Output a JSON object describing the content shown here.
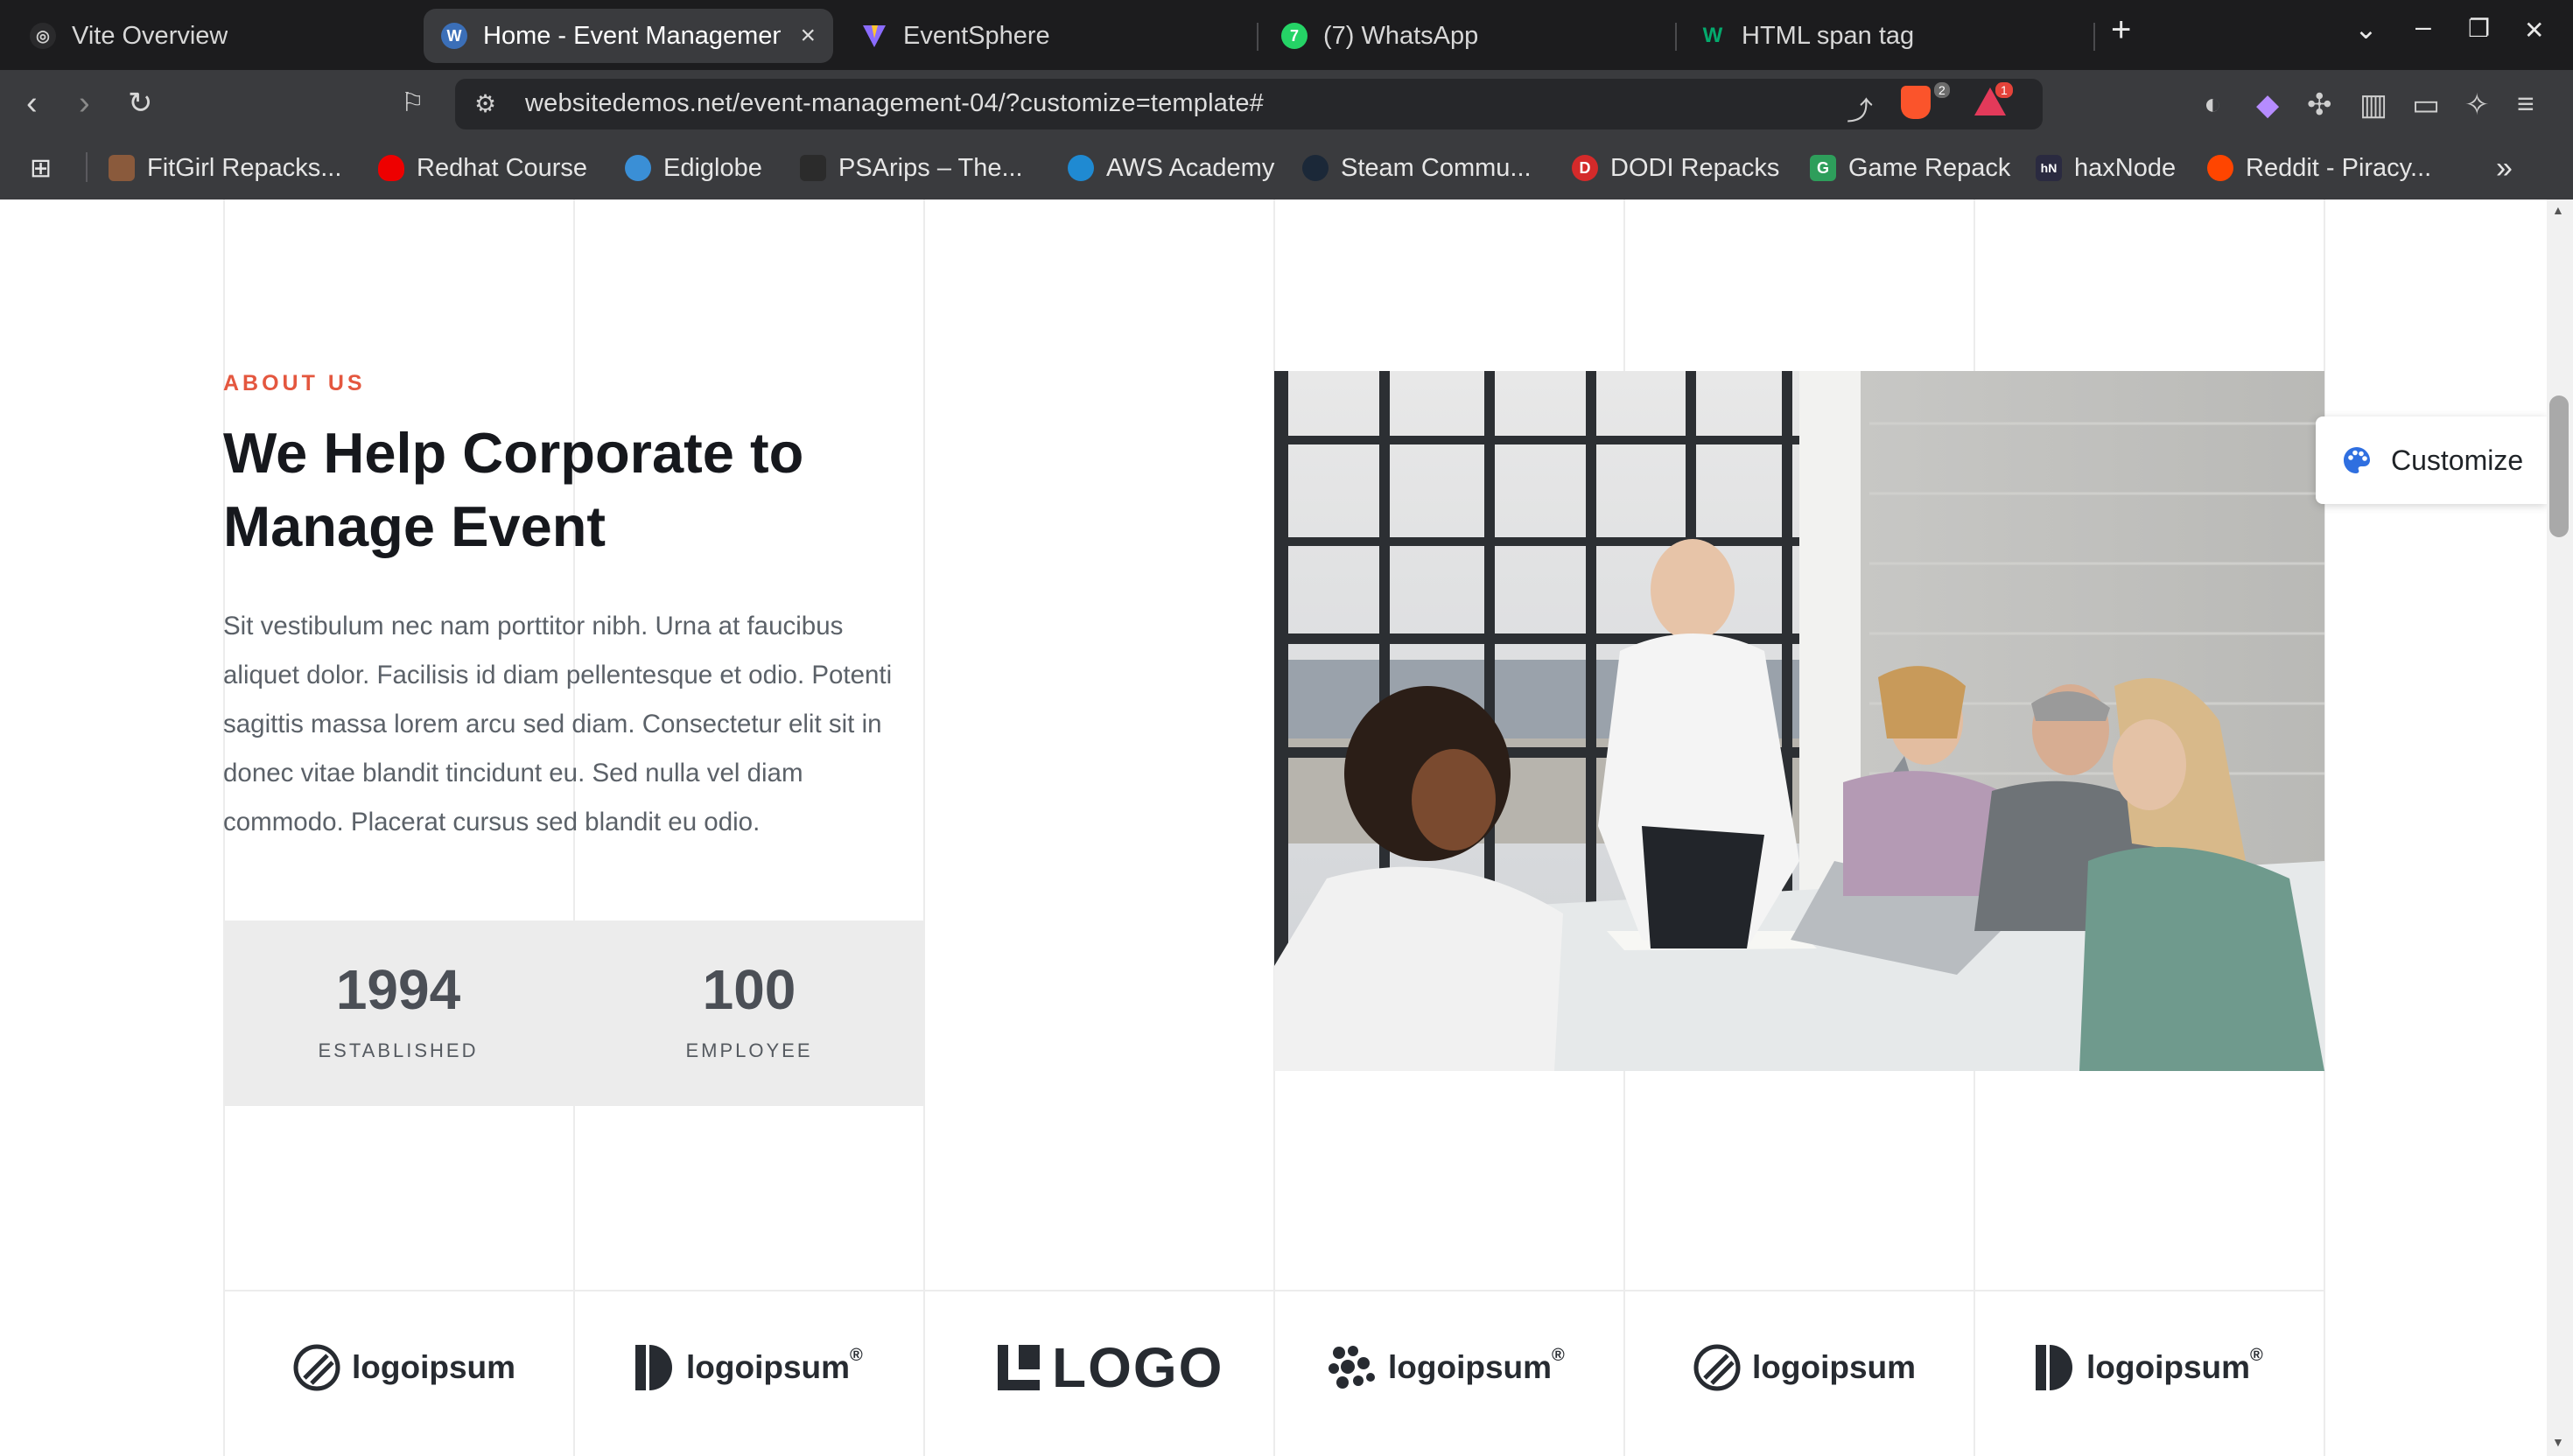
{
  "browser": {
    "tabs": [
      {
        "title": "Vite Overview",
        "icon": "vite-overview-icon",
        "active": false
      },
      {
        "title": "Home - Event Management",
        "icon": "wordpress-icon",
        "active": true
      },
      {
        "title": "EventSphere",
        "icon": "vite-logo-icon",
        "active": false
      },
      {
        "title": "(7) WhatsApp",
        "icon": "whatsapp-icon",
        "active": false
      },
      {
        "title": "HTML span tag",
        "icon": "w3-icon",
        "active": false
      }
    ],
    "new_tab": "+",
    "window_controls": {
      "dropdown": "⌄",
      "minimize": "–",
      "restore": "❐",
      "close": "✕"
    },
    "url": "websitedemos.net/event-management-04/?customize=template#",
    "brave_shield_count": "2",
    "rewards_count": "1",
    "bookmarks": [
      {
        "label": "FitGirl Repacks...",
        "icon": "fitgirl-icon"
      },
      {
        "label": "Redhat Course",
        "icon": "redhat-icon"
      },
      {
        "label": "Ediglobe",
        "icon": "ediglobe-icon"
      },
      {
        "label": "PSArips – The...",
        "icon": "psarips-icon"
      },
      {
        "label": "AWS Academy",
        "icon": "aws-icon"
      },
      {
        "label": "Steam Commu...",
        "icon": "steam-icon"
      },
      {
        "label": "DODI Repacks",
        "icon": "dodi-icon"
      },
      {
        "label": "Game Repack",
        "icon": "gamerepack-icon"
      },
      {
        "label": "haxNode",
        "icon": "haxnode-icon"
      },
      {
        "label": "Reddit - Piracy...",
        "icon": "reddit-icon"
      }
    ],
    "more_bookmarks": "»"
  },
  "page": {
    "eyebrow": "ABOUT US",
    "headline_line1": "We Help Corporate to",
    "headline_line2": "Manage Event",
    "paragraph": "Sit vestibulum nec nam porttitor nibh. Urna at faucibus aliquet dolor. Facilisis id diam pellentesque et odio. Potenti sagittis massa lorem arcu sed diam. Consectetur elit sit in donec vitae blandit tincidunt eu. Sed nulla vel diam commodo. Placerat cursus sed blandit eu odio.",
    "stats": [
      {
        "number": "1994",
        "label": "ESTABLISHED"
      },
      {
        "number": "100",
        "label": "EMPLOYEE"
      }
    ],
    "customize_label": "Customize",
    "logos": [
      {
        "text": "logoipsum",
        "icon": "circle-stripe-logo-icon"
      },
      {
        "text": "logoipsum",
        "suffix": "®",
        "icon": "half-circle-logo-icon"
      },
      {
        "text": "LOGO",
        "icon": "block-logo-icon"
      },
      {
        "text": "logoipsum",
        "suffix": "®",
        "icon": "dots-logo-icon"
      },
      {
        "text": "logoipsum",
        "icon": "circle-stripe-logo-icon"
      },
      {
        "text": "logoipsum",
        "suffix": "®",
        "icon": "half-circle-logo-icon"
      }
    ]
  },
  "colors": {
    "accent": "#e4573f",
    "heading": "#16181d",
    "body_text": "#5b6168",
    "stat_bg": "#ececec",
    "chrome_bg": "#1c1c1e",
    "toolbar_bg": "#3a3b3e"
  }
}
